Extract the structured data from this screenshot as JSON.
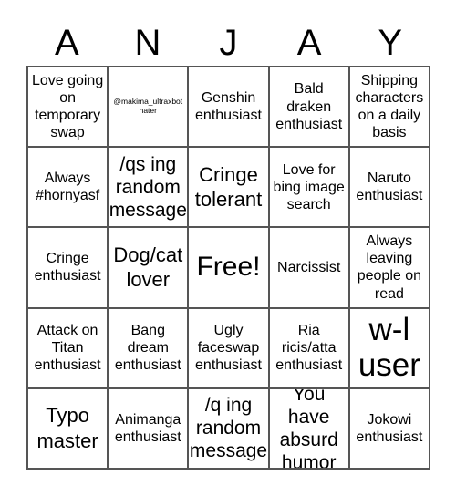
{
  "title_letters": [
    "A",
    "N",
    "J",
    "A",
    "Y"
  ],
  "cells": [
    [
      "Love going on temporary swap",
      "@makima_ultraxbot hater",
      "Genshin enthusiast",
      "Bald draken enthusiast",
      "Shipping characters on a daily basis"
    ],
    [
      "Always #hornyasf",
      "/qs ing random message",
      "Cringe tolerant",
      "Love for bing image search",
      "Naruto enthusiast"
    ],
    [
      "Cringe enthusiast",
      "Dog/cat lover",
      "Free!",
      "Narcissist",
      "Always leaving people on read"
    ],
    [
      "Attack on Titan enthusiast",
      "Bang dream enthusiast",
      "Ugly faceswap enthusiast",
      "Ria ricis/atta enthusiast",
      "w-l user"
    ],
    [
      "Typo master",
      "Animanga enthusiast",
      "/q ing random message",
      "You have absurd humor",
      "Jokowi enthusiast"
    ]
  ]
}
